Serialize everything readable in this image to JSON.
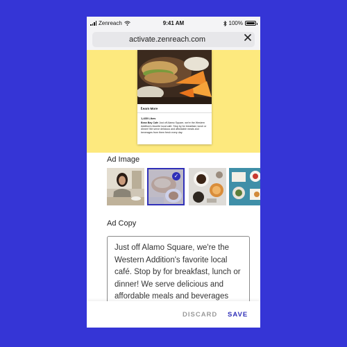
{
  "status_bar": {
    "carrier": "Zenreach",
    "time": "9:41 AM",
    "battery": "100%",
    "icons": [
      "signal-icon",
      "wifi-icon",
      "bluetooth-icon",
      "battery-icon"
    ]
  },
  "browser": {
    "url": "activate.zenreach.com",
    "close_icon": "close-icon"
  },
  "ad_preview": {
    "learn_more": "Learn More",
    "likes": "1,435 Likes",
    "description_business": "Bean Bay Cafe",
    "description_rest": "Just off Alamo Square, we're the Western Addition's favorite local café. Stop by for breakfast, lunch or dinner! We serve delicious and affordable meals and beverages from them fresh every day."
  },
  "ad_image": {
    "label": "Ad Image",
    "images": [
      {
        "name": "woman-at-table",
        "selected": false
      },
      {
        "name": "bread-and-tea",
        "selected": true
      },
      {
        "name": "coffee-flatlay",
        "selected": false
      },
      {
        "name": "blue-table-food",
        "selected": false
      }
    ]
  },
  "ad_copy": {
    "label": "Ad Copy",
    "text": "Just off Alamo Square, we're the Western Addition's favorite local café. Stop by for breakfast, lunch or dinner! We serve delicious and affordable meals and beverages from them fresh every day."
  },
  "footer": {
    "discard": "DISCARD",
    "save": "SAVE"
  },
  "colors": {
    "background": "#3535d6",
    "hero": "#fde97e",
    "accent": "#2f2fb8"
  }
}
